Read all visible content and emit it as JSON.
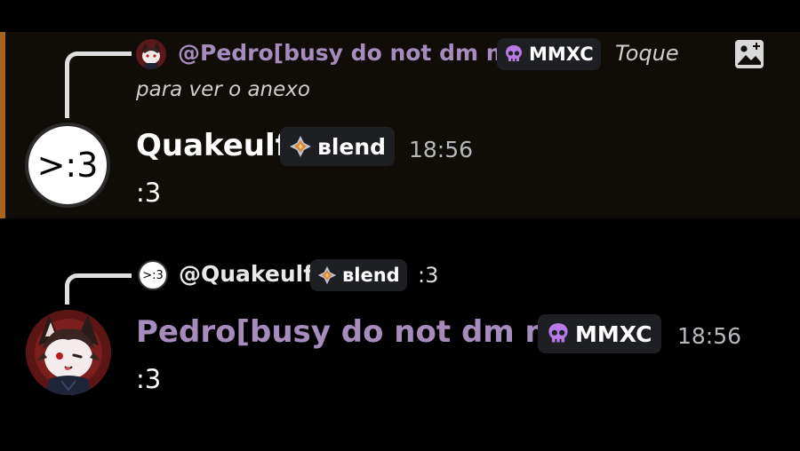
{
  "message1": {
    "reply": {
      "mention": "@Pedro[busy do not dm me]",
      "tag_label": "MMXC",
      "preview_line1": "Toque",
      "preview_line2": "para ver o anexo"
    },
    "author": "Quakeulf",
    "author_tag": "вlend",
    "avatar_text": ">:3",
    "time": "18:56",
    "content": ":3"
  },
  "message2": {
    "reply": {
      "avatar_text": ">:3",
      "mention": "@Quakeulf",
      "tag_label": "вlend",
      "preview": ":3"
    },
    "author": "Pedro[busy do not dm me]",
    "author_tag": "MMXC",
    "time": "18:56",
    "content": ":3"
  },
  "colors": {
    "highlight_bg": "#100d09",
    "highlight_bar": "#a8661c",
    "role_purple": "#a58cbd",
    "tag_bg": "#1e1f22",
    "timestamp": "#b5b8bd"
  },
  "icons": [
    "skull-icon",
    "blend-diamond-icon",
    "image-attachment-icon",
    "reply-connector-line"
  ]
}
